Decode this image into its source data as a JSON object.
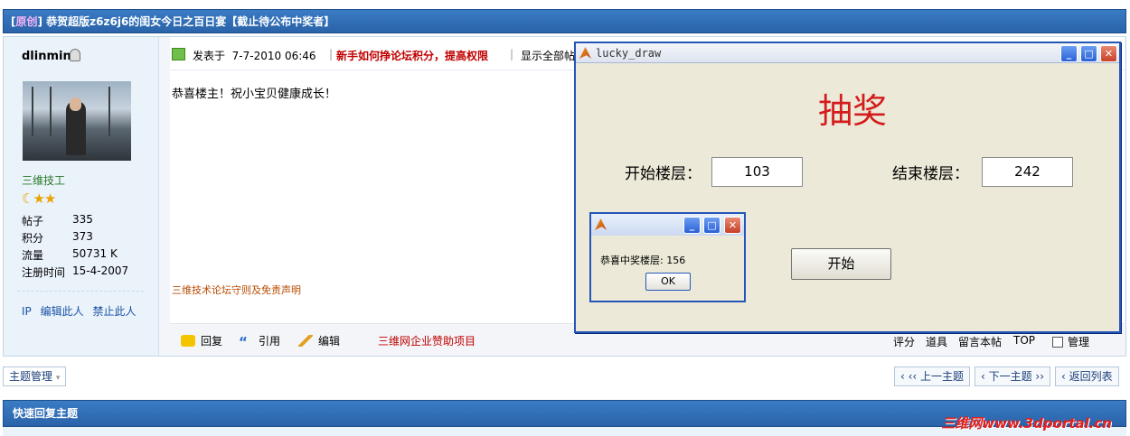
{
  "thread": {
    "tag": "原创",
    "title": "恭贺超版z6z6j6的闺女今日之百日宴【截止待公布中奖者】"
  },
  "user": {
    "name": "dlinmin",
    "rank": "三维技工",
    "stars": "☾★★",
    "stats": [
      {
        "label": "帖子",
        "value": "335"
      },
      {
        "label": "积分",
        "value": "373"
      },
      {
        "label": "流量",
        "value": "50731 K"
      },
      {
        "label": "注册时间",
        "value": "15-4-2007"
      }
    ],
    "links": [
      "IP",
      "编辑此人",
      "禁止此人"
    ]
  },
  "post": {
    "posted_label": "发表于",
    "posted_time": "7-7-2010 06:46",
    "promo": "新手如何挣论坛积分，提高权限",
    "show_all": "显示全部帖",
    "message": "恭喜楼主！祝小宝贝健康成长！",
    "rules": "三维技术论坛守则及免责声明",
    "actions": {
      "reply": "回复",
      "quote": "引用",
      "edit": "编辑"
    },
    "sponsor": "三维网企业赞助项目",
    "right_actions": [
      "评分",
      "道具",
      "留言本帖",
      "TOP"
    ],
    "manage": "管理"
  },
  "nav": {
    "topic_manage": "主题管理",
    "prev": "‹ ‹‹ 上一主题",
    "next": "‹ 下一主题 ››",
    "back": "‹ 返回列表"
  },
  "quick_reply": "快速回复主题",
  "watermark": "三维网www.3dportal.cn",
  "window": {
    "title": "lucky_draw",
    "heading": "抽奖",
    "start_label": "开始楼层：",
    "start_value": "103",
    "end_label": "结束楼层：",
    "end_value": "242",
    "start_button": "开始"
  },
  "dialog": {
    "message": "恭喜中奖楼层: 156",
    "ok": "OK"
  },
  "colors": {
    "header_blue": "#2a63a9",
    "accent_red": "#c00000",
    "dialog_bg": "#ece9d8"
  }
}
